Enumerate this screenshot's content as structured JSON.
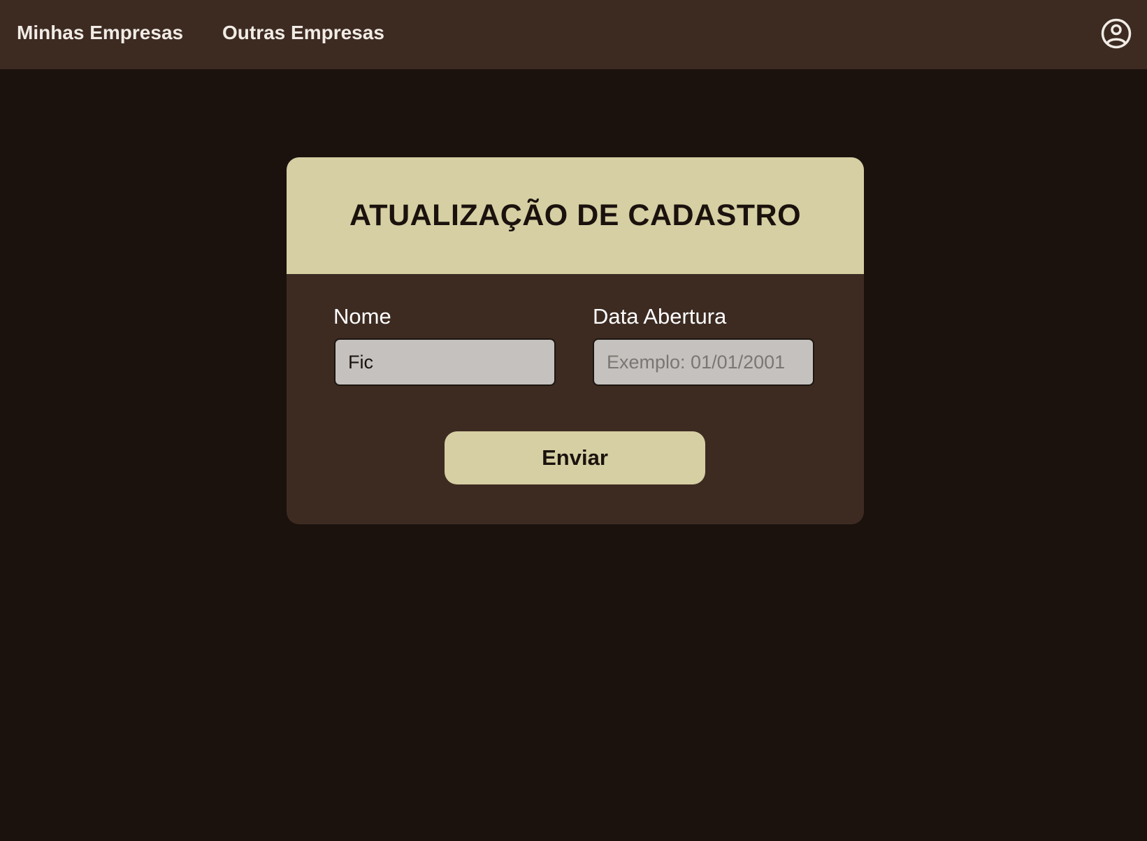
{
  "nav": {
    "links": [
      {
        "label": "Minhas Empresas"
      },
      {
        "label": "Outras Empresas"
      }
    ],
    "user_icon": "user-circle-icon"
  },
  "form": {
    "title": "ATUALIZAÇÃO DE CADASTRO",
    "fields": {
      "nome": {
        "label": "Nome",
        "value": "Fic",
        "placeholder": ""
      },
      "data_abertura": {
        "label": "Data Abertura",
        "value": "",
        "placeholder": "Exemplo: 01/01/2001"
      }
    },
    "submit_label": "Enviar"
  },
  "colors": {
    "background": "#1b120e",
    "surface": "#3d2b22",
    "accent": "#d5cfa3",
    "input_bg": "#c4c1be",
    "text_light": "#ffffff",
    "text_dark": "#1b120e"
  }
}
